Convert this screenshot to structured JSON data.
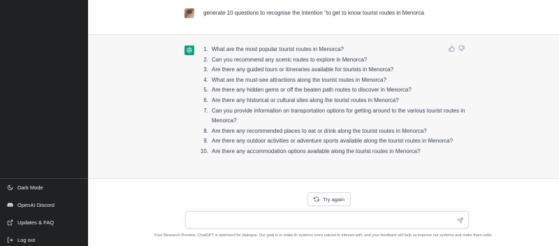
{
  "sidebar": {
    "items": [
      {
        "label": "Dark Mode",
        "icon": "moon-icon"
      },
      {
        "label": "OpenAI Discord",
        "icon": "discord-icon"
      },
      {
        "label": "Updates & FAQ",
        "icon": "external-link-icon"
      },
      {
        "label": "Log out",
        "icon": "logout-icon"
      }
    ]
  },
  "conversation": {
    "user_message": "generate 10 questions to recognise the intention \"to get to know tourist routes in Menorca",
    "answers": [
      {
        "num": "1.",
        "text": "What are the most popular tourist routes in Menorca?"
      },
      {
        "num": "2.",
        "text": "Can you recommend any scenic routes to explore in Menorca?"
      },
      {
        "num": "3.",
        "text": "Are there any guided tours or itineraries available for tourists in Menorca?"
      },
      {
        "num": "4.",
        "text": "What are the must-see attractions along the tourist routes in Menorca?"
      },
      {
        "num": "5.",
        "text": "Are there any hidden gems or off the beaten path routes to discover in Menorca?"
      },
      {
        "num": "6.",
        "text": "Are there any historical or cultural sites along the tourist routes in Menorca?"
      },
      {
        "num": "7.",
        "text": "Can you provide information on transportation options for getting around to the various tourist routes in Menorca?"
      },
      {
        "num": "8.",
        "text": "Are there any recommended places to eat or drink along the tourist routes in Menorca?"
      },
      {
        "num": "9.",
        "text": "Are there any outdoor activities or adventure sports available along the tourist routes in Menorca?"
      },
      {
        "num": "10.",
        "text": "Are there any accommodation options available along the tourist routes in Menorca?"
      }
    ]
  },
  "actions": {
    "try_again_label": "Try again"
  },
  "composer": {
    "value": "",
    "placeholder": ""
  },
  "footer": {
    "text": "Free Research Preview: ChatGPT is optimized for dialogue. Our goal is to make AI systems more natural to interact with, and your feedback will help us improve our systems and make them safer."
  },
  "colors": {
    "sidebar_bg": "#202123",
    "assistant_bg": "#f7f7f8",
    "brand_green": "#10a37f"
  }
}
